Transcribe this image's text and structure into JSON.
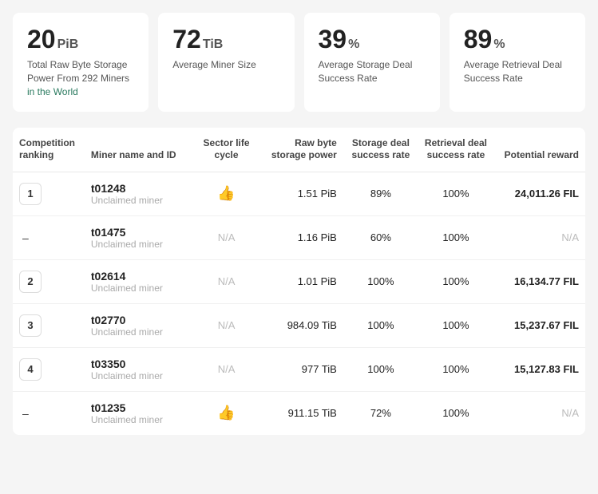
{
  "stats": [
    {
      "value": "20",
      "unit": "PiB",
      "label": "Total Raw Byte Storage Power From 292 Miners",
      "highlight": "in the World"
    },
    {
      "value": "72",
      "unit": "TiB",
      "label": "Average Miner Size",
      "highlight": ""
    },
    {
      "value": "39",
      "unit": "%",
      "label": "Average Storage Deal Success Rate",
      "highlight": ""
    },
    {
      "value": "89",
      "unit": "%",
      "label": "Average Retrieval Deal Success Rate",
      "highlight": ""
    }
  ],
  "table": {
    "headers": {
      "ranking": "Competition ranking",
      "miner": "Miner name and ID",
      "lifecycle": "Sector life cycle",
      "rawbyte": "Raw byte storage power",
      "storage_rate": "Storage deal success rate",
      "retrieval_rate": "Retrieval deal success rate",
      "reward": "Potential reward"
    },
    "rows": [
      {
        "rank": "1",
        "rank_type": "number",
        "miner_id": "t01248",
        "miner_sub": "Unclaimed miner",
        "lifecycle": "thumb",
        "raw_byte": "1.51 PiB",
        "storage_rate": "89%",
        "retrieval_rate": "100%",
        "reward": "24,011.26 FIL",
        "reward_type": "value"
      },
      {
        "rank": "–",
        "rank_type": "dash",
        "miner_id": "t01475",
        "miner_sub": "Unclaimed miner",
        "lifecycle": "N/A",
        "raw_byte": "1.16 PiB",
        "storage_rate": "60%",
        "retrieval_rate": "100%",
        "reward": "N/A",
        "reward_type": "na"
      },
      {
        "rank": "2",
        "rank_type": "number",
        "miner_id": "t02614",
        "miner_sub": "Unclaimed miner",
        "lifecycle": "N/A",
        "raw_byte": "1.01 PiB",
        "storage_rate": "100%",
        "retrieval_rate": "100%",
        "reward": "16,134.77 FIL",
        "reward_type": "value"
      },
      {
        "rank": "3",
        "rank_type": "number",
        "miner_id": "t02770",
        "miner_sub": "Unclaimed miner",
        "lifecycle": "N/A",
        "raw_byte": "984.09 TiB",
        "storage_rate": "100%",
        "retrieval_rate": "100%",
        "reward": "15,237.67 FIL",
        "reward_type": "value"
      },
      {
        "rank": "4",
        "rank_type": "number",
        "miner_id": "t03350",
        "miner_sub": "Unclaimed miner",
        "lifecycle": "N/A",
        "raw_byte": "977 TiB",
        "storage_rate": "100%",
        "retrieval_rate": "100%",
        "reward": "15,127.83 FIL",
        "reward_type": "value"
      },
      {
        "rank": "–",
        "rank_type": "dash",
        "miner_id": "t01235",
        "miner_sub": "Unclaimed miner",
        "lifecycle": "thumb",
        "raw_byte": "911.15 TiB",
        "storage_rate": "72%",
        "retrieval_rate": "100%",
        "reward": "N/A",
        "reward_type": "na"
      }
    ]
  }
}
